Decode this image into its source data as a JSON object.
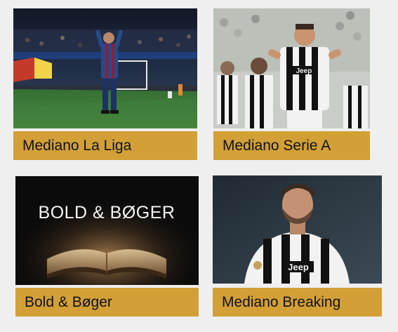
{
  "tiles": [
    {
      "label": "Mediano La Liga",
      "image": "soccer-player-celebrating-stadium",
      "colors": {
        "pitch": "#3e7d3a",
        "crowd": "#1c2333",
        "kit": "#274a8a"
      }
    },
    {
      "label": "Mediano Serie A",
      "image": "juventus-player-celebrating",
      "colors": {
        "kit_stripe": "#111111",
        "kit_base": "#f2f2f2"
      }
    },
    {
      "label": "Bold & Bøger",
      "image": "open-book-glowing",
      "image_text": "BOLD & BØGER",
      "colors": {
        "background": "#0b0b0b",
        "glow": "#c89a5a"
      }
    },
    {
      "label": "Mediano Breaking",
      "image": "juventus-player-portrait",
      "colors": {
        "background": "#2c3640",
        "kit_stripe": "#111111"
      }
    }
  ],
  "accent_color": "#d3a037",
  "page_background": "#efefef"
}
